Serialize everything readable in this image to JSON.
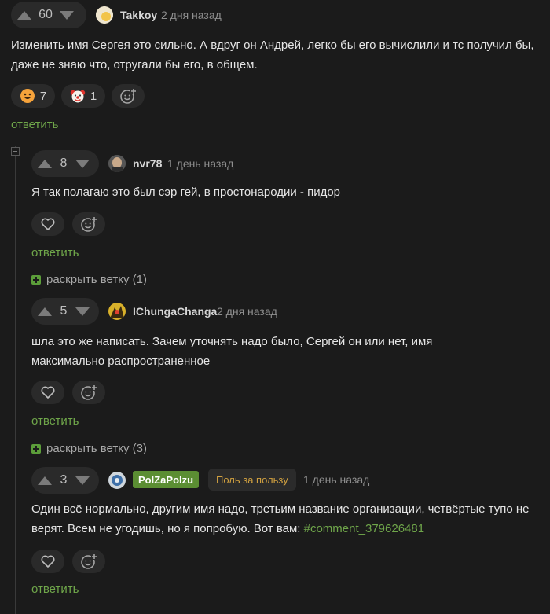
{
  "comments": [
    {
      "votes": "60",
      "username": "Takkoy",
      "time": "2 дня назад",
      "text": "Изменить имя Сергея это сильно. А вдруг он Андрей, легко бы его вычислили и тс получил бы, даже не знаю что, отругали бы его, в общем.",
      "reactions": [
        {
          "icon": "grinning-face-emoji",
          "count": "7"
        },
        {
          "icon": "clown-face-emoji",
          "count": "1"
        }
      ],
      "reply_label": "ответить"
    },
    {
      "votes": "8",
      "username": "nvr78",
      "time": "1 день назад",
      "text": "Я так полагаю это был сэр гей, в простонародии - пидор",
      "reply_label": "ответить",
      "expand_label": "раскрыть ветку (1)"
    },
    {
      "votes": "5",
      "username": "IChungaChanga",
      "time": "2 дня назад",
      "text_line1": "шла это же написать. Зачем уточнять надо было, Сергей он или нет, имя",
      "text_line2": "максимально распространенное",
      "reply_label": "ответить",
      "expand_label": "раскрыть ветку (3)"
    },
    {
      "votes": "3",
      "username": "PolZaPolzu",
      "badge": "Поль за пользу",
      "time": "1 день назад",
      "text_line1": "Один всё нормально, другим имя надо, третьим название организации, четвёртые тупо не",
      "text_line2_prefix": "верят. Всем не угодишь, но я попробую. Вот вам: ",
      "text_link": "#comment_379626481",
      "reply_label": "ответить"
    }
  ],
  "colors": {
    "background": "#1b1b1b",
    "link_green": "#6fa64a",
    "badge_green": "#5b8e33",
    "badge_gold": "#d0a040"
  }
}
